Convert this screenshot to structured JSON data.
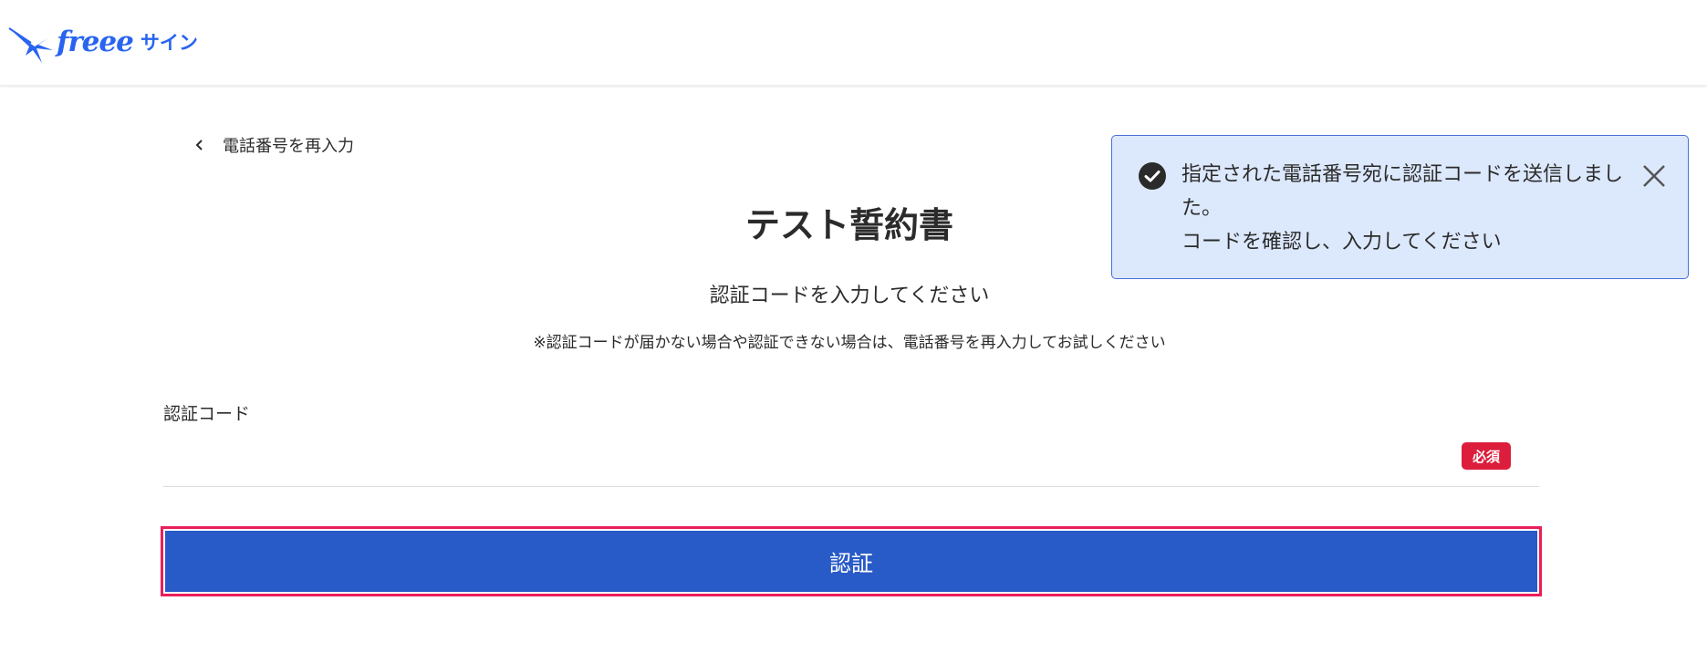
{
  "header": {
    "logo_word": "freee",
    "logo_sub": "サイン",
    "brand_color": "#2864f0"
  },
  "back_link": {
    "icon": "chevron-left-icon",
    "label": "電話番号を再入力"
  },
  "main": {
    "document_title": "テスト誓約書",
    "subtitle": "認証コードを入力してください",
    "note": "※認証コードが届かない場合や認証できない場合は、電話番号を再入力してお試しください"
  },
  "form": {
    "code_label": "認証コード",
    "code_value": "",
    "code_placeholder": "",
    "required_badge": "必須",
    "submit_label": "認証",
    "submit_color": "#285ac8",
    "required_color": "#dc1e3c",
    "focus_outline_color": "#eb1e5a"
  },
  "toast": {
    "icon": "check-circle-icon",
    "close_icon": "close-icon",
    "line1": "指定された電話番号宛に認証コードを送信しました。",
    "line2": "コードを確認し、入力してください",
    "background": "#dce8fc",
    "border": "#4a70d8"
  }
}
